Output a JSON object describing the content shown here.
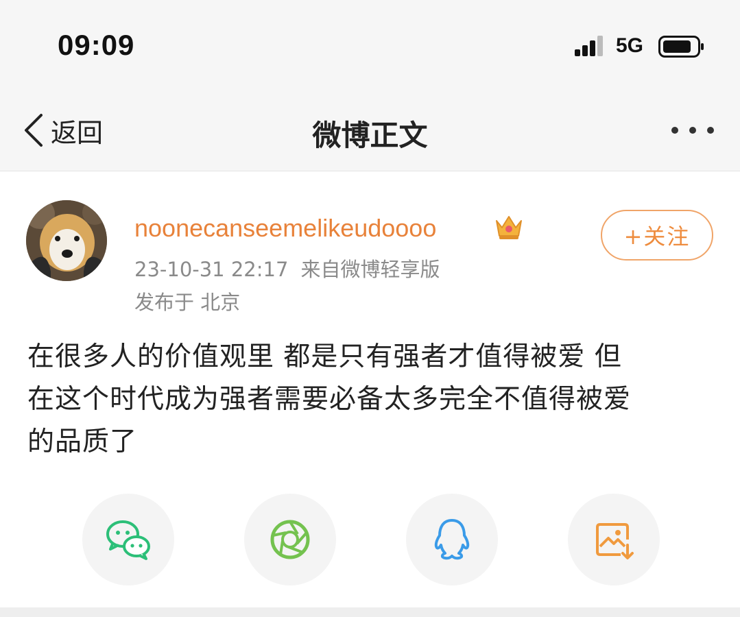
{
  "status_bar": {
    "time": "09:09",
    "network": "5G"
  },
  "nav": {
    "back_label": "返回",
    "title": "微博正文",
    "more_icon": "more-dots-icon"
  },
  "post": {
    "username": "noonecanseemelikeudoooo",
    "timestamp": "23-10-31 22:17",
    "source": "来自微博轻享版",
    "location": "发布于 北京",
    "follow_label": "+关注",
    "content_lines": [
      "在很多人的价值观里 都是只有强者才值得被爱 但",
      "在这个时代成为强者需要必备太多完全不值得被爱",
      "的品质了"
    ]
  },
  "share": {
    "items": [
      {
        "icon": "wechat-icon",
        "color": "#2cbf78"
      },
      {
        "icon": "moments-icon",
        "color": "#74c24f"
      },
      {
        "icon": "qq-icon",
        "color": "#3a9be8"
      },
      {
        "icon": "save-image-icon",
        "color": "#f09a3e"
      }
    ]
  },
  "colors": {
    "accent": "#e8823a",
    "meta_gray": "#8a8a8a"
  }
}
